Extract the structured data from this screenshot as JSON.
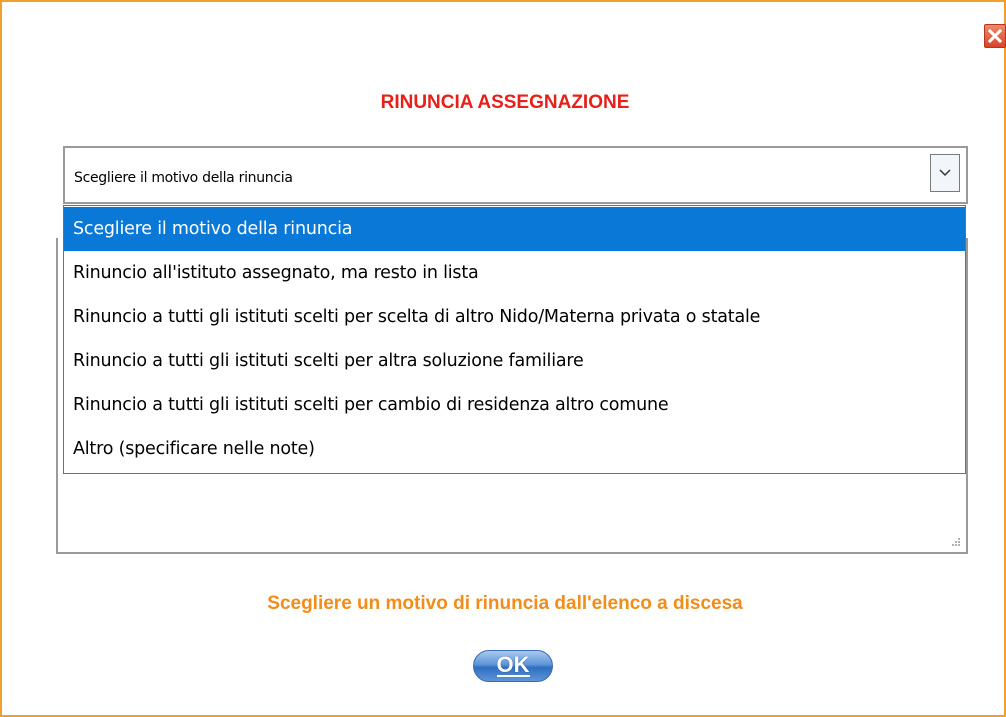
{
  "dialog": {
    "title": "RINUNCIA ASSEGNAZIONE",
    "close_icon": "close-icon",
    "hint": "Scegliere un motivo di rinuncia dall'elenco a discesa",
    "ok_label": "OK"
  },
  "reason_select": {
    "value": "Scegliere il motivo della rinuncia",
    "arrow_icon": "chevron-down-icon",
    "options": [
      "Scegliere il motivo della rinuncia",
      "Rinuncio all'istituto assegnato, ma resto in lista",
      "Rinuncio a tutti gli istituti scelti per scelta di altro Nido/Materna privata o statale",
      "Rinuncio a tutti gli istituti scelti per altra soluzione familiare",
      "Rinuncio a tutti gli istituti scelti per cambio di residenza altro comune",
      "Altro (specificare nelle note)"
    ],
    "highlighted_index": 0
  },
  "notes": {
    "value": ""
  },
  "colors": {
    "border": "#f0a030",
    "title": "#e8201a",
    "hint": "#f28c1a",
    "highlight": "#0a78d7"
  }
}
